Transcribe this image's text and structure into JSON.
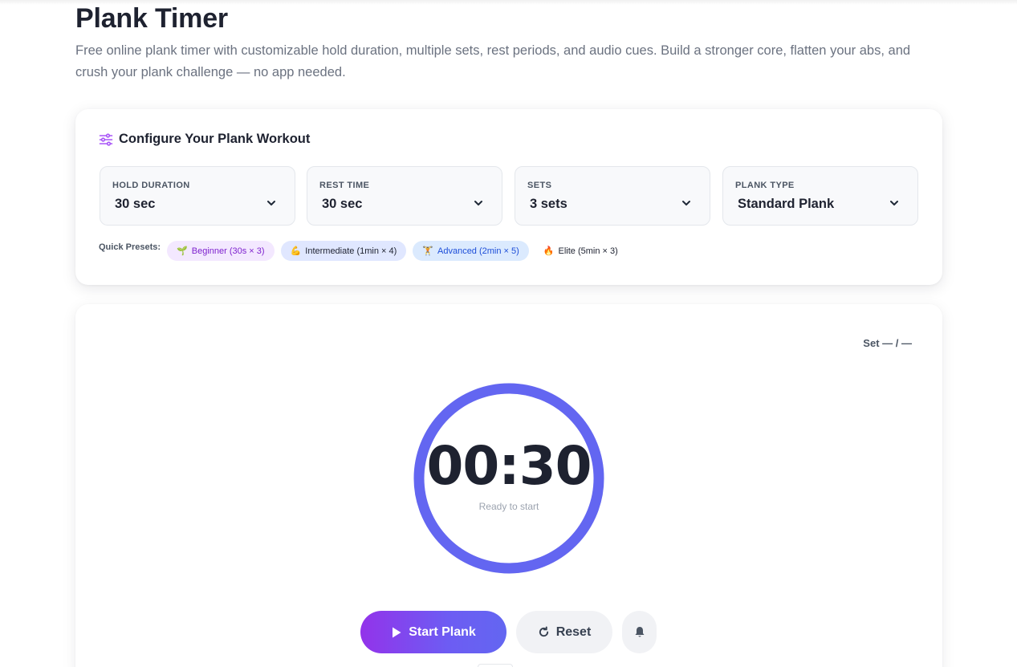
{
  "header": {
    "title": "Plank Timer",
    "description": "Free online plank timer with customizable hold duration, multiple sets, rest periods, and audio cues. Build a stronger core, flatten your abs, and crush your plank challenge — no app needed."
  },
  "config": {
    "title": "Configure Your Plank Workout",
    "icon": "sliders-icon",
    "selects": [
      {
        "label": "HOLD DURATION",
        "value": "30 sec"
      },
      {
        "label": "REST TIME",
        "value": "30 sec"
      },
      {
        "label": "SETS",
        "value": "3 sets"
      },
      {
        "label": "PLANK TYPE",
        "value": "Standard Plank"
      }
    ],
    "presets_label": "Quick Presets:",
    "presets": [
      {
        "emoji": "🌱",
        "label": "Beginner (30s × 3)"
      },
      {
        "emoji": "💪",
        "label": "Intermediate (1min × 4)"
      },
      {
        "emoji": "🏋",
        "label": "Advanced (2min × 5)"
      },
      {
        "emoji": "🔥",
        "label": "Elite (5min × 3)"
      }
    ]
  },
  "timer": {
    "set_label": "Set",
    "set_value": "— / —",
    "display": "00:30",
    "status": "Ready to start",
    "ring_progress": 1.0,
    "ring_color": "#6366f1"
  },
  "controls": {
    "start_label": "Start Plank",
    "reset_label": "Reset",
    "sound_icon": "bell-icon"
  },
  "colors": {
    "accent": "#6366f1",
    "accent_purple": "#9333ea"
  }
}
